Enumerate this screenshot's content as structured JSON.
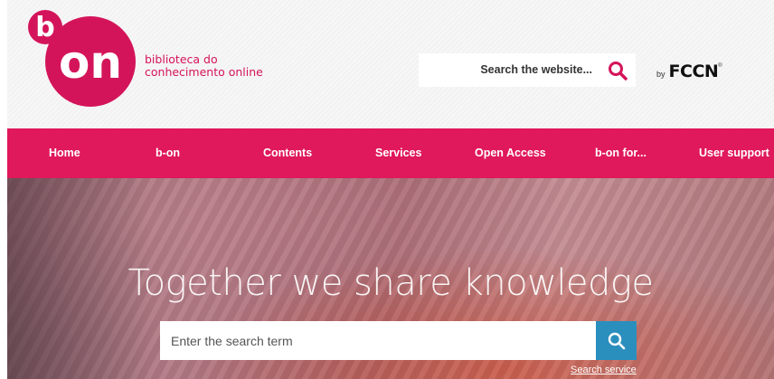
{
  "header": {
    "logo": {
      "letter_b": "b",
      "letters_on": "on"
    },
    "tagline": [
      "biblioteca do",
      "conhecimento online"
    ],
    "site_search": {
      "placeholder": "Search the website..."
    },
    "by_label": "by",
    "partner": "FCCN",
    "partner_mark": "®"
  },
  "nav": {
    "items": [
      {
        "label": "Home"
      },
      {
        "label": "b-on"
      },
      {
        "label": "Contents"
      },
      {
        "label": "Services"
      },
      {
        "label": "Open Access"
      },
      {
        "label": "b-on for..."
      },
      {
        "label": "User support"
      }
    ]
  },
  "hero": {
    "title": "Together we share knowledge",
    "search_placeholder": "Enter the search term",
    "search_service_link": "Search service"
  },
  "colors": {
    "brand": "#e0185c",
    "search_button": "#2b8fbe"
  },
  "icons": {
    "site_search": "search-icon",
    "hero_search": "search-icon"
  }
}
